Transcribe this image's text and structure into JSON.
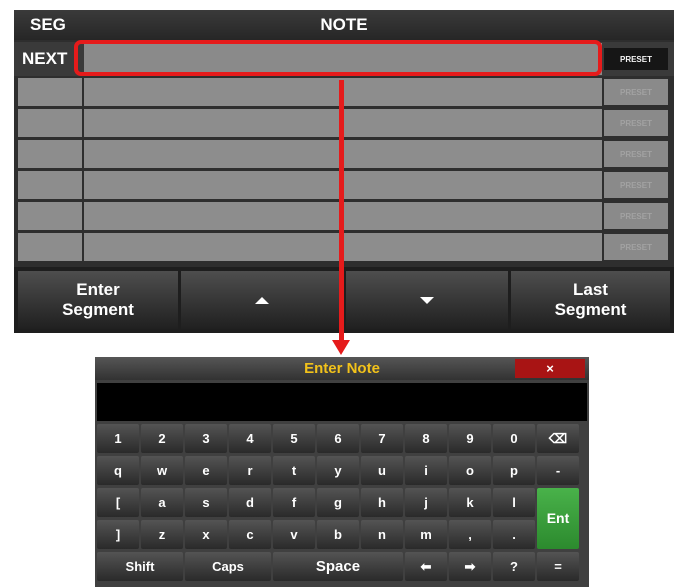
{
  "table": {
    "header": {
      "seg": "SEG",
      "note": "NOTE"
    },
    "next_label": "NEXT",
    "preset_label": "PRESET",
    "rows": 6
  },
  "buttons": {
    "enter_segment": [
      "Enter",
      "Segment"
    ],
    "last_segment": [
      "Last",
      "Segment"
    ]
  },
  "keyboard": {
    "title": "Enter Note",
    "close": "×",
    "row1": [
      "1",
      "2",
      "3",
      "4",
      "5",
      "6",
      "7",
      "8",
      "9",
      "0",
      "⌫"
    ],
    "row2": [
      "q",
      "w",
      "e",
      "r",
      "t",
      "y",
      "u",
      "i",
      "o",
      "p",
      "-"
    ],
    "row3": [
      "[",
      "a",
      "s",
      "d",
      "f",
      "g",
      "h",
      "j",
      "k",
      "l"
    ],
    "row4": [
      "]",
      "z",
      "x",
      "c",
      "v",
      "b",
      "n",
      "m",
      ",",
      "."
    ],
    "enter": "Ent",
    "shift": "Shift",
    "caps": "Caps",
    "space": "Space",
    "left": "⬅",
    "right": "➡",
    "question": "?",
    "equals": "="
  },
  "colors": {
    "highlight": "#e51b1b",
    "title_text": "#f2c21a",
    "enter_key": "#3a9e3b",
    "close_button": "#a81414"
  }
}
